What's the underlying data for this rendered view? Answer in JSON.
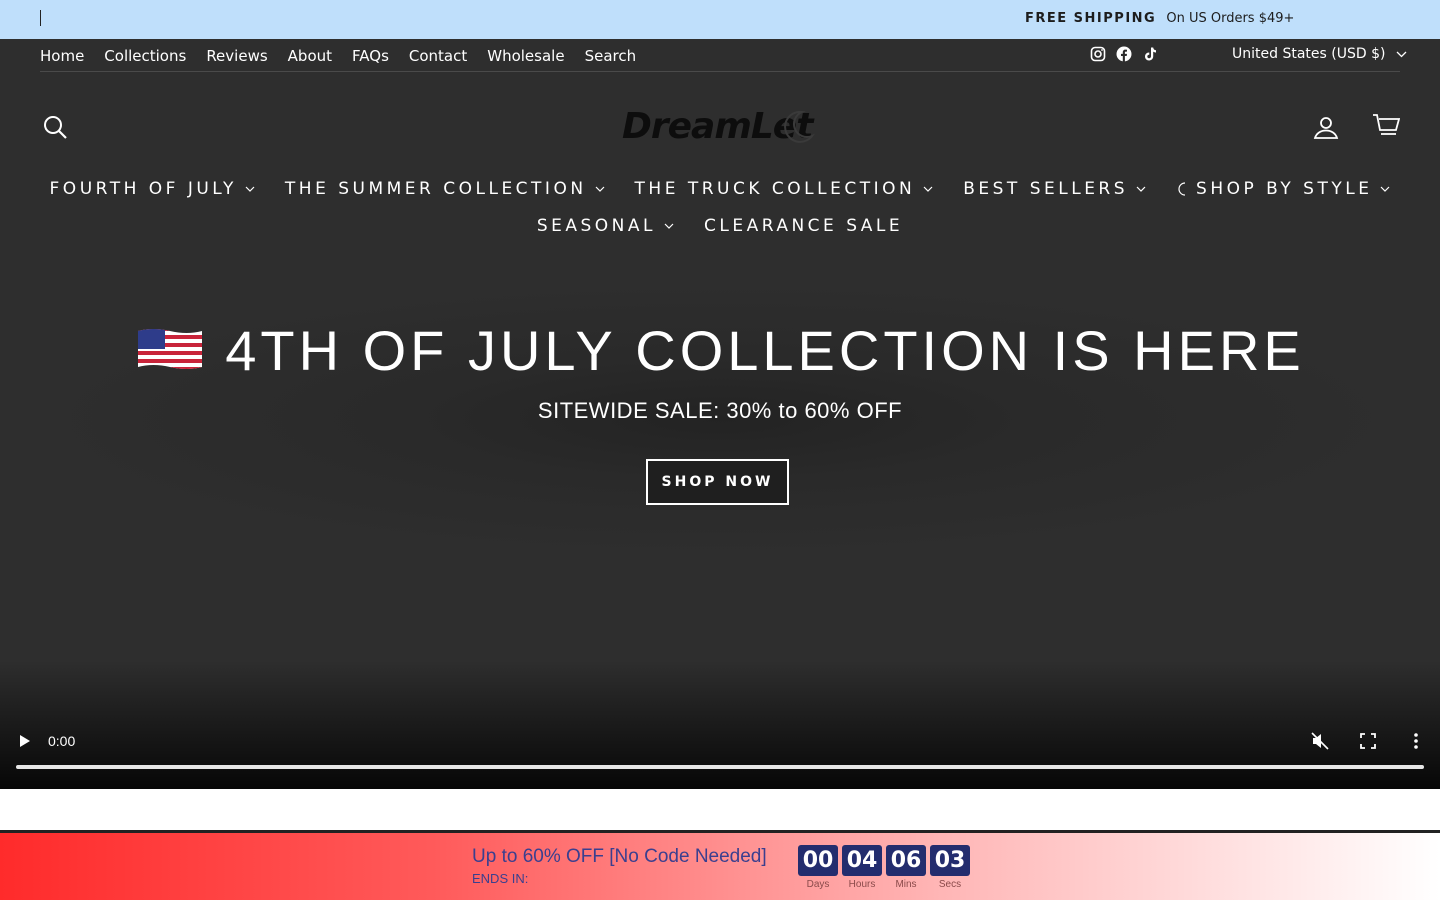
{
  "announcement": {
    "highlight": "FREE SHIPPING",
    "text": "On US Orders $49+"
  },
  "topnav": {
    "links": [
      "Home",
      "Collections",
      "Reviews",
      "About",
      "FAQs",
      "Contact",
      "Wholesale",
      "Search"
    ],
    "social_icons": [
      "instagram-icon",
      "facebook-icon",
      "tiktok-icon"
    ],
    "currency": "United States (USD $)"
  },
  "header": {
    "logo_text": "DreamLet",
    "icons": [
      "search-icon",
      "account-icon",
      "cart-icon"
    ]
  },
  "menu": {
    "row1": [
      "FOURTH OF JULY",
      "THE SUMMER COLLECTION",
      "THE TRUCK COLLECTION",
      "BEST SELLERS",
      "SHOP BY STYLE"
    ],
    "row2": [
      "SEASONAL",
      "CLEARANCE SALE"
    ]
  },
  "hero": {
    "title": "4TH OF JULY COLLECTION IS HERE",
    "subtitle": "SITEWIDE SALE: 30% to 60% OFF",
    "button": "SHOP NOW"
  },
  "video": {
    "time": "0:00"
  },
  "countdown": {
    "headline": "Up to 60% OFF [No Code Needed]",
    "ends_label": "ENDS IN:",
    "units": [
      {
        "value": "00",
        "label": "Days"
      },
      {
        "value": "04",
        "label": "Hours"
      },
      {
        "value": "06",
        "label": "Mins"
      },
      {
        "value": "03",
        "label": "Secs"
      }
    ]
  },
  "colors": {
    "announce_bg": "#bfdffb",
    "hero_bg": "#2c2c2c",
    "countdown_box": "#232d6e",
    "countdown_text": "#3b3f8f",
    "countdown_red": "#ff2b2b"
  }
}
